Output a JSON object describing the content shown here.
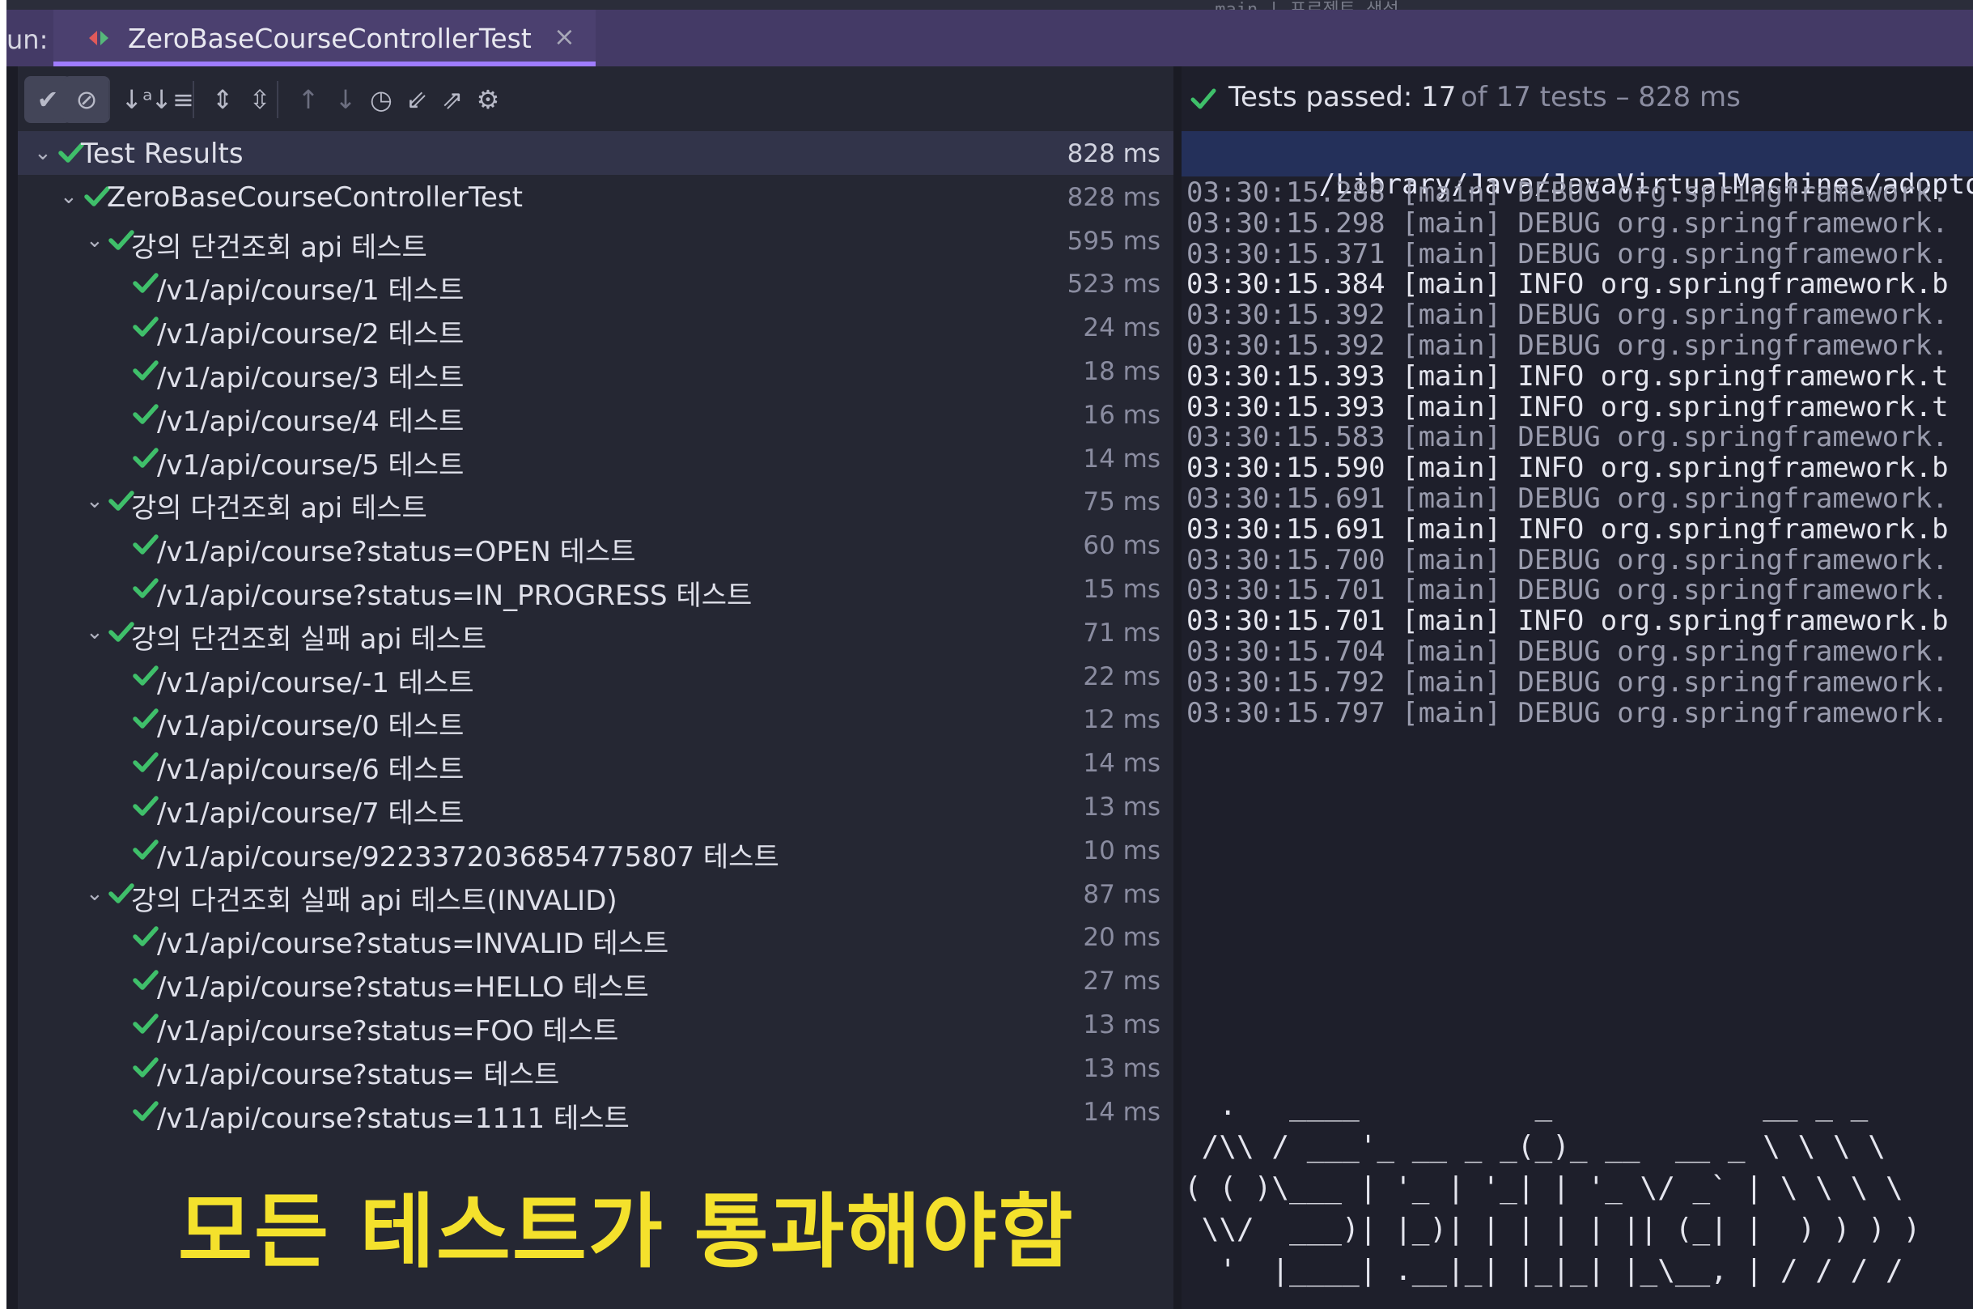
{
  "top_strip": {
    "text": "…main | 프로젝트 생성"
  },
  "tab_bar": {
    "run_label": "un:",
    "tab_title": "ZeroBaseCourseControllerTest",
    "close_glyph": "×"
  },
  "toolbar": {
    "buttons": [
      {
        "name": "show-passed-icon",
        "glyph": "✔",
        "active": true
      },
      {
        "name": "show-ignored-icon",
        "glyph": "⊘",
        "active": true
      },
      {
        "name": "sort-alphabetically-icon",
        "glyph": "↓ᵃ"
      },
      {
        "name": "sort-by-duration-icon",
        "glyph": "↓≡"
      },
      {
        "name": "expand-all-icon",
        "glyph": "⇕"
      },
      {
        "name": "collapse-all-icon",
        "glyph": "⇳"
      },
      {
        "name": "previous-failed-icon",
        "glyph": "↑",
        "dim": true
      },
      {
        "name": "next-failed-icon",
        "glyph": "↓",
        "dim": true
      },
      {
        "name": "test-history-icon",
        "glyph": "◷"
      },
      {
        "name": "import-tests-icon",
        "glyph": "⇙"
      },
      {
        "name": "export-tests-icon",
        "glyph": "⇗"
      },
      {
        "name": "settings-gear-icon",
        "glyph": "⚙"
      }
    ]
  },
  "test_tree": [
    {
      "level": 0,
      "label": "Test Results",
      "time": "828 ms",
      "expanded": true,
      "selected": true
    },
    {
      "level": 1,
      "label": "ZeroBaseCourseControllerTest",
      "time": "828 ms",
      "expanded": true
    },
    {
      "level": 2,
      "label": "강의 단건조회 api 테스트",
      "time": "595 ms",
      "expanded": true
    },
    {
      "level": 3,
      "label": "/v1/api/course/1 테스트",
      "time": "523 ms"
    },
    {
      "level": 3,
      "label": "/v1/api/course/2 테스트",
      "time": "24 ms"
    },
    {
      "level": 3,
      "label": "/v1/api/course/3 테스트",
      "time": "18 ms"
    },
    {
      "level": 3,
      "label": "/v1/api/course/4 테스트",
      "time": "16 ms"
    },
    {
      "level": 3,
      "label": "/v1/api/course/5 테스트",
      "time": "14 ms"
    },
    {
      "level": 2,
      "label": "강의 다건조회 api 테스트",
      "time": "75 ms",
      "expanded": true
    },
    {
      "level": 3,
      "label": "/v1/api/course?status=OPEN 테스트",
      "time": "60 ms"
    },
    {
      "level": 3,
      "label": "/v1/api/course?status=IN_PROGRESS 테스트",
      "time": "15 ms"
    },
    {
      "level": 2,
      "label": "강의 단건조회 실패 api 테스트",
      "time": "71 ms",
      "expanded": true
    },
    {
      "level": 3,
      "label": "/v1/api/course/-1 테스트",
      "time": "22 ms"
    },
    {
      "level": 3,
      "label": "/v1/api/course/0 테스트",
      "time": "12 ms"
    },
    {
      "level": 3,
      "label": "/v1/api/course/6 테스트",
      "time": "14 ms"
    },
    {
      "level": 3,
      "label": "/v1/api/course/7 테스트",
      "time": "13 ms"
    },
    {
      "level": 3,
      "label": "/v1/api/course/9223372036854775807 테스트",
      "time": "10 ms"
    },
    {
      "level": 2,
      "label": "강의 다건조회 실패 api 테스트(INVALID)",
      "time": "87 ms",
      "expanded": true
    },
    {
      "level": 3,
      "label": "/v1/api/course?status=INVALID 테스트",
      "time": "20 ms"
    },
    {
      "level": 3,
      "label": "/v1/api/course?status=HELLO 테스트",
      "time": "27 ms"
    },
    {
      "level": 3,
      "label": "/v1/api/course?status=FOO 테스트",
      "time": "13 ms"
    },
    {
      "level": 3,
      "label": "/v1/api/course?status= 테스트",
      "time": "13 ms"
    },
    {
      "level": 3,
      "label": "/v1/api/course?status=1111 테스트",
      "time": "14 ms"
    }
  ],
  "banner": {
    "text": "모든 테스트가 통과해야함"
  },
  "status": {
    "main": "Tests passed: 17",
    "rest": "of 17 tests – 828 ms"
  },
  "console": {
    "path_line": "/Library/Java/JavaVirtualMachines/adoptopenjdk",
    "lines": [
      {
        "level": "debug",
        "text": "03:30:15.288 [main] DEBUG org.springframework."
      },
      {
        "level": "debug",
        "text": "03:30:15.298 [main] DEBUG org.springframework."
      },
      {
        "level": "debug",
        "text": "03:30:15.371 [main] DEBUG org.springframework."
      },
      {
        "level": "info",
        "text": "03:30:15.384 [main] INFO org.springframework.b"
      },
      {
        "level": "debug",
        "text": "03:30:15.392 [main] DEBUG org.springframework."
      },
      {
        "level": "debug",
        "text": "03:30:15.392 [main] DEBUG org.springframework."
      },
      {
        "level": "info",
        "text": "03:30:15.393 [main] INFO org.springframework.t"
      },
      {
        "level": "info",
        "text": "03:30:15.393 [main] INFO org.springframework.t"
      },
      {
        "level": "debug",
        "text": "03:30:15.583 [main] DEBUG org.springframework."
      },
      {
        "level": "info",
        "text": "03:30:15.590 [main] INFO org.springframework.b"
      },
      {
        "level": "debug",
        "text": "03:30:15.691 [main] DEBUG org.springframework."
      },
      {
        "level": "info",
        "text": "03:30:15.691 [main] INFO org.springframework.b"
      },
      {
        "level": "debug",
        "text": "03:30:15.700 [main] DEBUG org.springframework."
      },
      {
        "level": "debug",
        "text": "03:30:15.701 [main] DEBUG org.springframework."
      },
      {
        "level": "info",
        "text": "03:30:15.701 [main] INFO org.springframework.b"
      },
      {
        "level": "debug",
        "text": "03:30:15.704 [main] DEBUG org.springframework."
      },
      {
        "level": "debug",
        "text": "03:30:15.792 [main] DEBUG org.springframework."
      },
      {
        "level": "debug",
        "text": "03:30:15.797 [main] DEBUG org.springframework."
      }
    ],
    "ascii_banner": [
      "  .   ____          _            __ _ _",
      " /\\\\ / ___'_ __ _ _(_)_ __  __ _ \\ \\ \\ \\",
      "( ( )\\___ | '_ | '_| | '_ \\/ _` | \\ \\ \\ \\",
      " \\\\/  ___)| |_)| | | | | || (_| |  ) ) ) )",
      "  '  |____| .__|_| |_|_| |_\\__, | / / / /"
    ]
  },
  "colors": {
    "accent": "#9f7cff",
    "pass_green": "#3fbf6a",
    "banner_yellow": "#f4e12c",
    "tab_bar": "#443a66",
    "panel": "#252733"
  }
}
